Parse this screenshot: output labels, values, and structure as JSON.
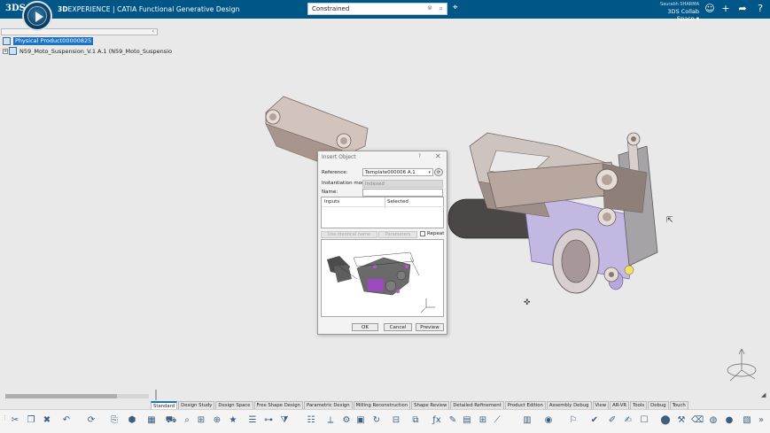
{
  "header": {
    "logo": "3DS",
    "brand": "3D",
    "brand_rest": "EXPERIENCE",
    "app_name": " | CATIA Functional Generative Design",
    "search_value": "Constrained",
    "user_name": "Saurabh SHARMA",
    "collab_space": "3DS Collab Space"
  },
  "tree": {
    "root_label": "Physical Product00000825",
    "child_label": "N59_Moto_Suspension_V.1 A.1 (N59_Moto_Suspensio"
  },
  "dialog": {
    "title": "Insert Object",
    "help": "?",
    "close": "✕",
    "reference_label": "Reference:",
    "reference_value": "Template000006 A.1",
    "mode_label": "Instantiation mode:",
    "mode_value": "Indexed",
    "name_label": "Name:",
    "inputs_header": "Inputs",
    "selected_header": "Selected",
    "use_identical_label": "Use identical name",
    "parameters_label": "Parameters",
    "repeat_label": "Repeat",
    "ok_label": "OK",
    "cancel_label": "Cancel",
    "preview_label": "Preview"
  },
  "tabs": [
    "Standard",
    "Design Study",
    "Design Space",
    "Free Shape Design",
    "Parametric Design",
    "Milling Reconstruction",
    "Shape Review",
    "Detailed Refinement",
    "Product Edition",
    "Assembly Debug",
    "View",
    "AR-VR",
    "Tools",
    "Debug",
    "Touch"
  ],
  "active_tab": "Standard",
  "colors": {
    "topbar": "#005686",
    "selection": "#1a73c9",
    "part_metal": "#c9b8b0",
    "part_purple": "#b9a8de",
    "part_dark": "#3a3a3a"
  },
  "icons": {
    "search": "search-icon",
    "tag": "tag-icon",
    "user": "user-icon",
    "add": "plus-icon",
    "share": "share-icon",
    "help": "help-icon"
  }
}
